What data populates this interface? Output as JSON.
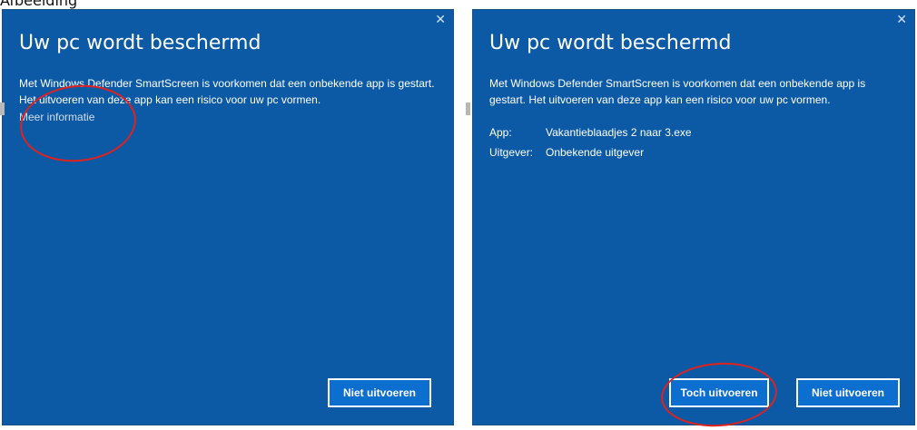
{
  "caption": "Afbeelding",
  "dialogs": [
    {
      "title": "Uw pc wordt beschermd",
      "close_glyph": "✕",
      "message": "Met Windows Defender SmartScreen is voorkomen dat een onbekende app is gestart. Het uitvoeren van deze app kan een risico voor uw pc vormen.",
      "more_info_link": "Meer informatie",
      "buttons": {
        "dont_run": "Niet uitvoeren"
      }
    },
    {
      "title": "Uw pc wordt beschermd",
      "close_glyph": "✕",
      "message": "Met Windows Defender SmartScreen is voorkomen dat een onbekende app is gestart. Het uitvoeren van deze app kan een risico voor uw pc vormen.",
      "details": [
        {
          "label": "App:",
          "value": "Vakantieblaadjes 2 naar 3.exe"
        },
        {
          "label": "Uitgever:",
          "value": "Onbekende uitgever"
        }
      ],
      "buttons": {
        "run_anyway": "Toch uitvoeren",
        "dont_run": "Niet uitvoeren"
      }
    }
  ],
  "colors": {
    "dialog_background": "#0c5aa6",
    "button_background": "#0c6fd0",
    "annotation_red": "#e0221e"
  }
}
